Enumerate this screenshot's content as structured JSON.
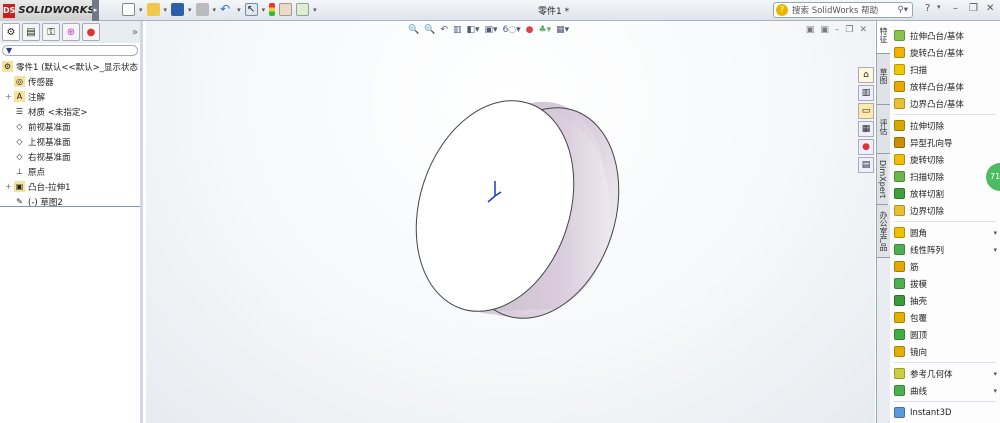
{
  "app": {
    "name": "SOLIDWORKS",
    "title": "零件1 *"
  },
  "toolbar": {
    "items": [
      "new-icon",
      "open-icon",
      "save-icon",
      "print-icon",
      "undo-icon",
      "select-icon",
      "rebuild-icon",
      "file-properties-icon",
      "options-icon"
    ]
  },
  "search": {
    "placeholder": "搜索 SolidWorks 帮助"
  },
  "window_controls": {
    "help": "?",
    "minimize": "–",
    "restore": "❐",
    "close": "✕"
  },
  "left_panel": {
    "filter": "▼",
    "more": "»",
    "tree": [
      {
        "label": "零件1 (默认<<默认>_显示状态",
        "icon": "part-icon",
        "expand": ""
      },
      {
        "label": "传感器",
        "icon": "sensor-icon",
        "expand": ""
      },
      {
        "label": "注解",
        "icon": "annotation-icon",
        "expand": "+"
      },
      {
        "label": "材质 <未指定>",
        "icon": "material-icon",
        "expand": ""
      },
      {
        "label": "前视基准面",
        "icon": "plane-icon",
        "expand": ""
      },
      {
        "label": "上视基准面",
        "icon": "plane-icon",
        "expand": ""
      },
      {
        "label": "右视基准面",
        "icon": "plane-icon",
        "expand": ""
      },
      {
        "label": "原点",
        "icon": "origin-icon",
        "expand": ""
      },
      {
        "label": "凸台-拉伸1",
        "icon": "extrude-icon",
        "expand": "+"
      },
      {
        "label": "(-) 草图2",
        "icon": "sketch-icon",
        "expand": ""
      }
    ]
  },
  "task_tabs": [
    "特征",
    "草图",
    "评估",
    "DimXpert",
    "办公室产品"
  ],
  "commands": [
    {
      "label": "拉伸凸台/基体",
      "color": "#8bc34a"
    },
    {
      "label": "旋转凸台/基体",
      "color": "#f0b400"
    },
    {
      "label": "扫描",
      "color": "#f0c800"
    },
    {
      "label": "放样凸台/基体",
      "color": "#e8a800"
    },
    {
      "label": "边界凸台/基体",
      "color": "#e8c030"
    },
    {
      "label": "拉伸切除",
      "color": "#d8a800"
    },
    {
      "label": "异型孔向导",
      "color": "#c89000"
    },
    {
      "label": "旋转切除",
      "color": "#f0c000"
    },
    {
      "label": "扫描切除",
      "color": "#6bb84a"
    },
    {
      "label": "放样切割",
      "color": "#3fa040"
    },
    {
      "label": "边界切除",
      "color": "#e8c030"
    },
    {
      "label": "圆角",
      "color": "#f0c000",
      "dropdown": true
    },
    {
      "label": "线性阵列",
      "color": "#4caf50",
      "dropdown": true
    },
    {
      "label": "筋",
      "color": "#e0a800"
    },
    {
      "label": "拔模",
      "color": "#4caf50"
    },
    {
      "label": "抽壳",
      "color": "#3a9a3a"
    },
    {
      "label": "包覆",
      "color": "#e0b000"
    },
    {
      "label": "圆顶",
      "color": "#3fae3f"
    },
    {
      "label": "镜向",
      "color": "#e0b000"
    },
    {
      "label": "参考几何体",
      "color": "#c8d040",
      "dropdown": true
    },
    {
      "label": "曲线",
      "color": "#4caf50",
      "dropdown": true
    },
    {
      "label": "Instant3D",
      "color": "#5a9ad8"
    }
  ],
  "bubble": "71"
}
